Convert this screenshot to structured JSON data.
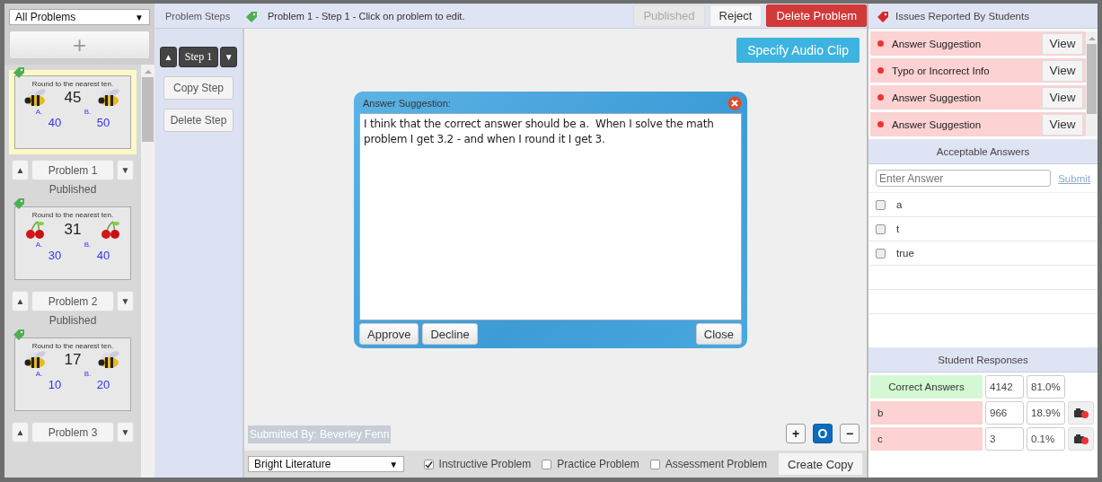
{
  "filter": {
    "value": "All Problems",
    "caret": "▼"
  },
  "add_button": {
    "label": "+"
  },
  "problems": [
    {
      "prompt": "Round to the nearest ten.",
      "number": "45",
      "kind": "bee",
      "options": [
        {
          "letter": "A.",
          "value": "40"
        },
        {
          "letter": "B.",
          "value": "50"
        }
      ],
      "selected": true,
      "up": "▲",
      "title": "Problem 1",
      "down": "▼",
      "status": "Published"
    },
    {
      "prompt": "Round to the nearest ten.",
      "number": "31",
      "kind": "cherry",
      "options": [
        {
          "letter": "A.",
          "value": "30"
        },
        {
          "letter": "B.",
          "value": "40"
        }
      ],
      "selected": false,
      "up": "▲",
      "title": "Problem 2",
      "down": "▼",
      "status": "Published"
    },
    {
      "prompt": "Round to the nearest ten.",
      "number": "17",
      "kind": "bee",
      "options": [
        {
          "letter": "A.",
          "value": "10"
        },
        {
          "letter": "B.",
          "value": "20"
        }
      ],
      "selected": false,
      "up": "▲",
      "title": "Problem 3",
      "down": "▼"
    }
  ],
  "steps": {
    "label": "Problem Steps",
    "up": "▲",
    "current": "Step 1",
    "down": "▼",
    "actions": [
      "Copy Step",
      "Delete Step"
    ]
  },
  "top_bar": {
    "breadcrumb": "Problem 1 - Step 1 - Click on problem to edit.",
    "actions": [
      {
        "label": "Published",
        "disabled": true,
        "kind": "plain"
      },
      {
        "label": "Reject",
        "disabled": false,
        "kind": "plain"
      },
      {
        "label": "Delete Problem",
        "disabled": false,
        "kind": "danger"
      }
    ]
  },
  "canvas": {
    "audio_button": "Specify Audio Clip",
    "submitted_by": "Submitted By: Beverley Fenn",
    "zoom": {
      "plus": "+",
      "reset": "O",
      "minus": "−"
    }
  },
  "dialog": {
    "title": "Answer Suggestion:",
    "text": "I think that the correct answer should be a.  When I solve the math problem I get 3.2 - and when I round it I get 3.",
    "buttons": [
      "Approve",
      "Decline"
    ],
    "close_label": "Close"
  },
  "bottom_bar": {
    "library": "Bright Literature",
    "caret": "▼",
    "problem_types": [
      {
        "label": "Instructive Problem",
        "checked": true
      },
      {
        "label": "Practice Problem",
        "checked": false
      },
      {
        "label": "Assessment Problem",
        "checked": false
      }
    ],
    "create_copy": "Create Copy"
  },
  "issues": {
    "title": "Issues Reported By Students",
    "items": [
      {
        "label": "Answer Suggestion",
        "action": "View"
      },
      {
        "label": "Typo or Incorrect Info",
        "action": "View"
      },
      {
        "label": "Answer Suggestion",
        "action": "View"
      },
      {
        "label": "Answer Suggestion",
        "action": "View"
      }
    ]
  },
  "answers": {
    "title": "Acceptable Answers",
    "placeholder": "Enter Answer",
    "submit": "Submit",
    "items": [
      {
        "text": "a",
        "checked": false
      },
      {
        "text": "t",
        "checked": false
      },
      {
        "text": "true",
        "checked": false
      }
    ]
  },
  "responses": {
    "title": "Student Responses",
    "rows": [
      {
        "kind": "correct",
        "answer": "Correct Answers",
        "count": "4142",
        "percent": "81.0%"
      },
      {
        "kind": "incorrect",
        "answer": "b",
        "count": "966",
        "percent": "18.9%"
      },
      {
        "kind": "incorrect",
        "answer": "c",
        "count": "3",
        "percent": "0.1%"
      }
    ]
  }
}
